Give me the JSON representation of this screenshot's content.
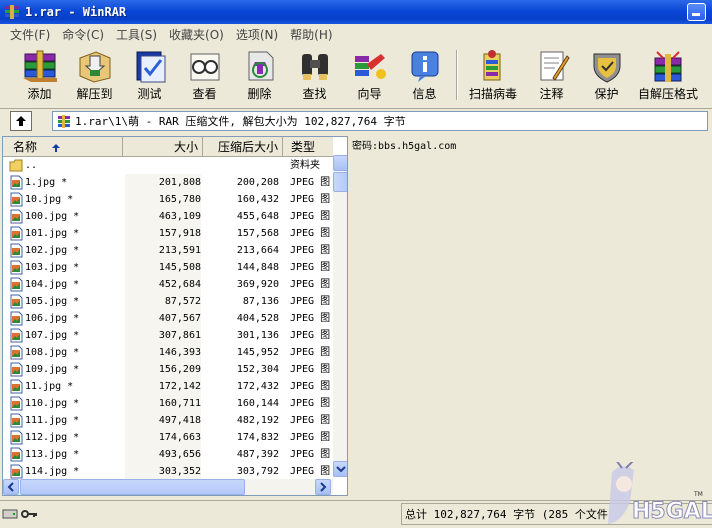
{
  "window": {
    "title": "1.rar - WinRAR"
  },
  "menu": [
    "文件(F)",
    "命令(C)",
    "工具(S)",
    "收藏夹(O)",
    "选项(N)",
    "帮助(H)"
  ],
  "toolbar": {
    "buttons": [
      {
        "label": "添加",
        "icon": "add-books-icon"
      },
      {
        "label": "解压到",
        "icon": "extract-to-icon"
      },
      {
        "label": "测试",
        "icon": "test-icon"
      },
      {
        "label": "查看",
        "icon": "view-glasses-icon"
      },
      {
        "label": "删除",
        "icon": "delete-recycle-icon"
      },
      {
        "label": "查找",
        "icon": "binoculars-icon"
      },
      {
        "label": "向导",
        "icon": "wizard-icon"
      },
      {
        "label": "信息",
        "icon": "info-icon"
      }
    ],
    "buttons2": [
      {
        "label": "扫描病毒",
        "icon": "virus-scan-icon"
      },
      {
        "label": "注释",
        "icon": "comment-icon"
      },
      {
        "label": "保护",
        "icon": "protect-shield-icon"
      },
      {
        "label": "自解压格式",
        "icon": "sfx-icon"
      }
    ]
  },
  "address": {
    "path": "1.rar\\1\\萌 - RAR 压缩文件, 解包大小为 102,827,764 字节"
  },
  "file_list": {
    "columns": {
      "name": "名称",
      "size": "大小",
      "packed": "压缩后大小",
      "type": "类型"
    },
    "parent": {
      "name": "..",
      "type": "资料夹"
    },
    "rows": [
      {
        "name": "1.jpg *",
        "size": "201,808",
        "packed": "200,208",
        "type": "JPEG 图"
      },
      {
        "name": "10.jpg *",
        "size": "165,780",
        "packed": "160,432",
        "type": "JPEG 图"
      },
      {
        "name": "100.jpg *",
        "size": "463,109",
        "packed": "455,648",
        "type": "JPEG 图"
      },
      {
        "name": "101.jpg *",
        "size": "157,918",
        "packed": "157,568",
        "type": "JPEG 图"
      },
      {
        "name": "102.jpg *",
        "size": "213,591",
        "packed": "213,664",
        "type": "JPEG 图"
      },
      {
        "name": "103.jpg *",
        "size": "145,508",
        "packed": "144,848",
        "type": "JPEG 图"
      },
      {
        "name": "104.jpg *",
        "size": "452,684",
        "packed": "369,920",
        "type": "JPEG 图"
      },
      {
        "name": "105.jpg *",
        "size": "87,572",
        "packed": "87,136",
        "type": "JPEG 图"
      },
      {
        "name": "106.jpg *",
        "size": "407,567",
        "packed": "404,528",
        "type": "JPEG 图"
      },
      {
        "name": "107.jpg *",
        "size": "307,861",
        "packed": "301,136",
        "type": "JPEG 图"
      },
      {
        "name": "108.jpg *",
        "size": "146,393",
        "packed": "145,952",
        "type": "JPEG 图"
      },
      {
        "name": "109.jpg *",
        "size": "156,209",
        "packed": "152,304",
        "type": "JPEG 图"
      },
      {
        "name": "11.jpg *",
        "size": "172,142",
        "packed": "172,432",
        "type": "JPEG 图"
      },
      {
        "name": "110.jpg *",
        "size": "160,711",
        "packed": "160,144",
        "type": "JPEG 图"
      },
      {
        "name": "111.jpg *",
        "size": "497,418",
        "packed": "482,192",
        "type": "JPEG 图"
      },
      {
        "name": "112.jpg *",
        "size": "174,663",
        "packed": "174,832",
        "type": "JPEG 图"
      },
      {
        "name": "113.jpg *",
        "size": "493,656",
        "packed": "487,392",
        "type": "JPEG 图"
      },
      {
        "name": "114.jpg *",
        "size": "303,352",
        "packed": "303,792",
        "type": "JPEG 图"
      }
    ]
  },
  "comment": {
    "text": "密码:bbs.h5gal.com"
  },
  "status": {
    "text": "总计 102,827,764 字节 (285 个文件"
  },
  "colors": {
    "titlebar": "#0a48d8",
    "window": "#ece9d8",
    "list_bg": "#ffffff",
    "scroll_button": "#b4c8f8"
  }
}
